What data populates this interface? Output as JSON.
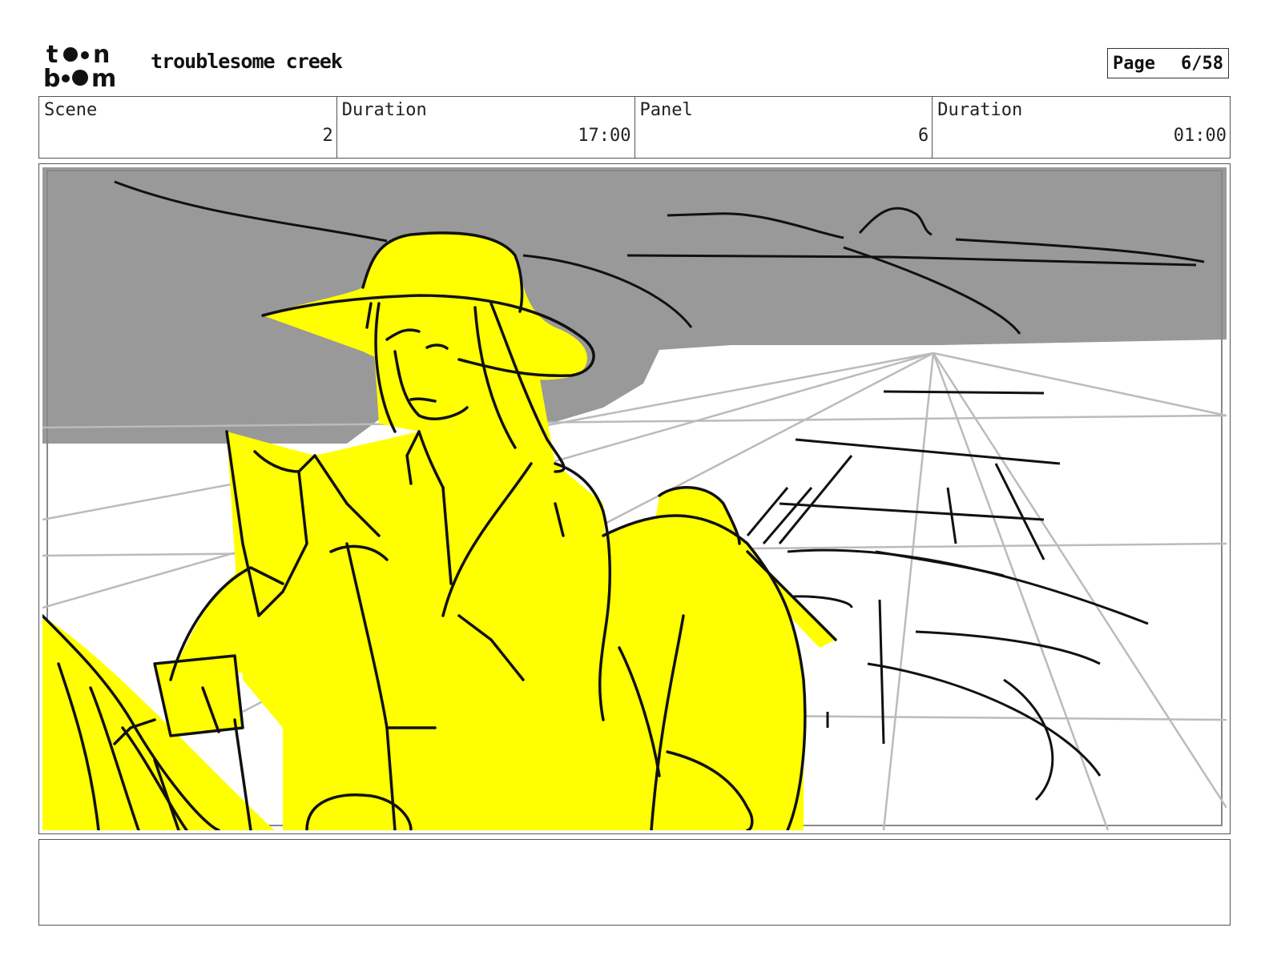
{
  "header": {
    "logo_top": "t••n",
    "logo_bottom": "b••m",
    "project_title": "troublesome creek",
    "page_label": "Page",
    "page_value": "6/58"
  },
  "info": {
    "scene_label": "Scene",
    "scene_value": "2",
    "scene_duration_label": "Duration",
    "scene_duration_value": "17:00",
    "panel_label": "Panel",
    "panel_value": "6",
    "panel_duration_label": "Duration",
    "panel_duration_value": "01:00"
  },
  "colors": {
    "sky": "#999999",
    "highlight": "#ffff00",
    "ink": "#111111",
    "guide": "#bbbbbb"
  }
}
